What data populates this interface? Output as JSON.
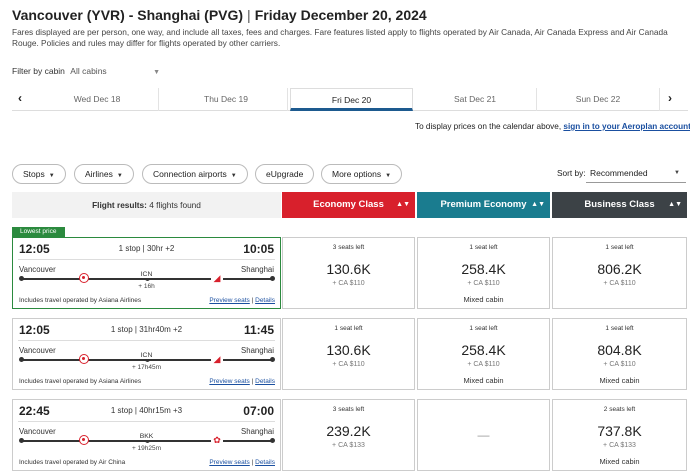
{
  "header": {
    "route": "Vancouver (YVR) - Shanghai (PVG)",
    "separator": "|",
    "date": "Friday December 20, 2024",
    "fare_note": "Fares displayed are per person, one way, and include all taxes, fees and charges. Fare features listed apply to flights operated by Air Canada, Air Canada Express and Air Canada Rouge. Policies and rules may differ for flights operated by other carriers."
  },
  "filter": {
    "label": "Filter by cabin",
    "value": "All cabins"
  },
  "dates": [
    {
      "label": "Wed Dec 18",
      "active": false
    },
    {
      "label": "Thu Dec 19",
      "active": false
    },
    {
      "label": "Fri Dec 20",
      "active": true
    },
    {
      "label": "Sat Dec 21",
      "active": false
    },
    {
      "label": "Sun Dec 22",
      "active": false
    }
  ],
  "calendar_note": {
    "text": "To display prices on the calendar above,",
    "link": "sign in to your Aeroplan account."
  },
  "chips": [
    "Stops",
    "Airlines",
    "Connection airports",
    "eUpgrade",
    "More options"
  ],
  "sort": {
    "label": "Sort by:",
    "value": "Recommended"
  },
  "results": {
    "label": "Flight results:",
    "count": "4 flights found"
  },
  "cabins": {
    "economy": "Economy Class",
    "premium": "Premium Economy",
    "business": "Business Class"
  },
  "badge": "Lowest price",
  "flights": [
    {
      "dep": "12:05",
      "arr": "10:05",
      "summary": "1 stop | 30hr +2",
      "origin": "Vancouver",
      "dest": "Shanghai",
      "stop": "ICN",
      "layover": "+ 16h",
      "operated": "Includes travel operated by Asiana Airlines",
      "preview": "Preview seats",
      "sep": "|",
      "details": "Details",
      "economy": {
        "seats": "3 seats left",
        "points": "130.6K",
        "tax": "+ CA $110"
      },
      "premium": {
        "seats": "1 seat left",
        "points": "258.4K",
        "tax": "+ CA $110",
        "note": "Mixed cabin"
      },
      "business": {
        "seats": "1 seat left",
        "points": "806.2K",
        "tax": "+ CA $110"
      }
    },
    {
      "dep": "12:05",
      "arr": "11:45",
      "summary": "1 stop | 31hr40m +2",
      "origin": "Vancouver",
      "dest": "Shanghai",
      "stop": "ICN",
      "layover": "+ 17h45m",
      "operated": "Includes travel operated by Asiana Airlines",
      "preview": "Preview seats",
      "sep": "|",
      "details": "Details",
      "economy": {
        "seats": "1 seat left",
        "points": "130.6K",
        "tax": "+ CA $110"
      },
      "premium": {
        "seats": "1 seat left",
        "points": "258.4K",
        "tax": "+ CA $110",
        "note": "Mixed cabin"
      },
      "business": {
        "seats": "1 seat left",
        "points": "804.8K",
        "tax": "+ CA $110",
        "note": "Mixed cabin"
      }
    },
    {
      "dep": "22:45",
      "arr": "07:00",
      "summary": "1 stop | 40hr15m +3",
      "origin": "Vancouver",
      "dest": "Shanghai",
      "stop": "BKK",
      "layover": "+ 19h25m",
      "operated": "Includes travel operated by Air China",
      "preview": "Preview seats",
      "sep": "|",
      "details": "Details",
      "economy": {
        "seats": "3 seats left",
        "points": "239.2K",
        "tax": "+ CA $133"
      },
      "premium": {
        "na": "—"
      },
      "business": {
        "seats": "2 seats left",
        "points": "737.8K",
        "tax": "+ CA $133",
        "note": "Mixed cabin"
      }
    }
  ]
}
